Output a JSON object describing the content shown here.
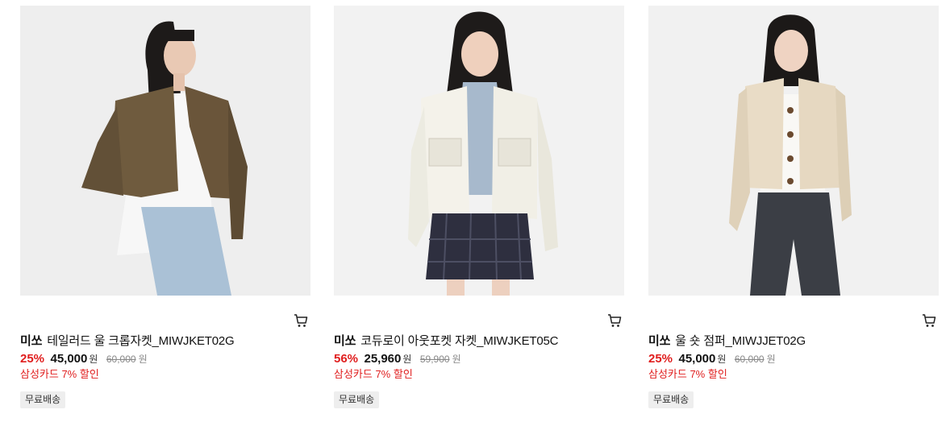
{
  "products": [
    {
      "brand": "미쏘",
      "name": "테일러드 울 크롭자켓_MIWJKET02G",
      "discount_rate": "25%",
      "sale_price": "45,000",
      "unit": "원",
      "original_price": "60,000",
      "card_promo": "삼성카드 7% 할인",
      "badge": "무료배송",
      "image_label": "model-brown-tailored-crop-jacket"
    },
    {
      "brand": "미쏘",
      "name": "코듀로이 아웃포켓 자켓_MIWJKET05C",
      "discount_rate": "56%",
      "sale_price": "25,960",
      "unit": "원",
      "original_price": "59,900",
      "card_promo": "삼성카드 7% 할인",
      "badge": "무료배송",
      "image_label": "model-ivory-corduroy-jacket"
    },
    {
      "brand": "미쏘",
      "name": "울 숏 점퍼_MIWJJET02G",
      "discount_rate": "25%",
      "sale_price": "45,000",
      "unit": "원",
      "original_price": "60,000",
      "card_promo": "삼성카드 7% 할인",
      "badge": "무료배송",
      "image_label": "model-beige-wool-short-jumper"
    }
  ],
  "icons": {
    "cart": "cart-icon"
  },
  "colors": {
    "discount": "#e01e1e",
    "badge_bg": "#eeeeee",
    "image_bg": "#f1f1f1"
  }
}
